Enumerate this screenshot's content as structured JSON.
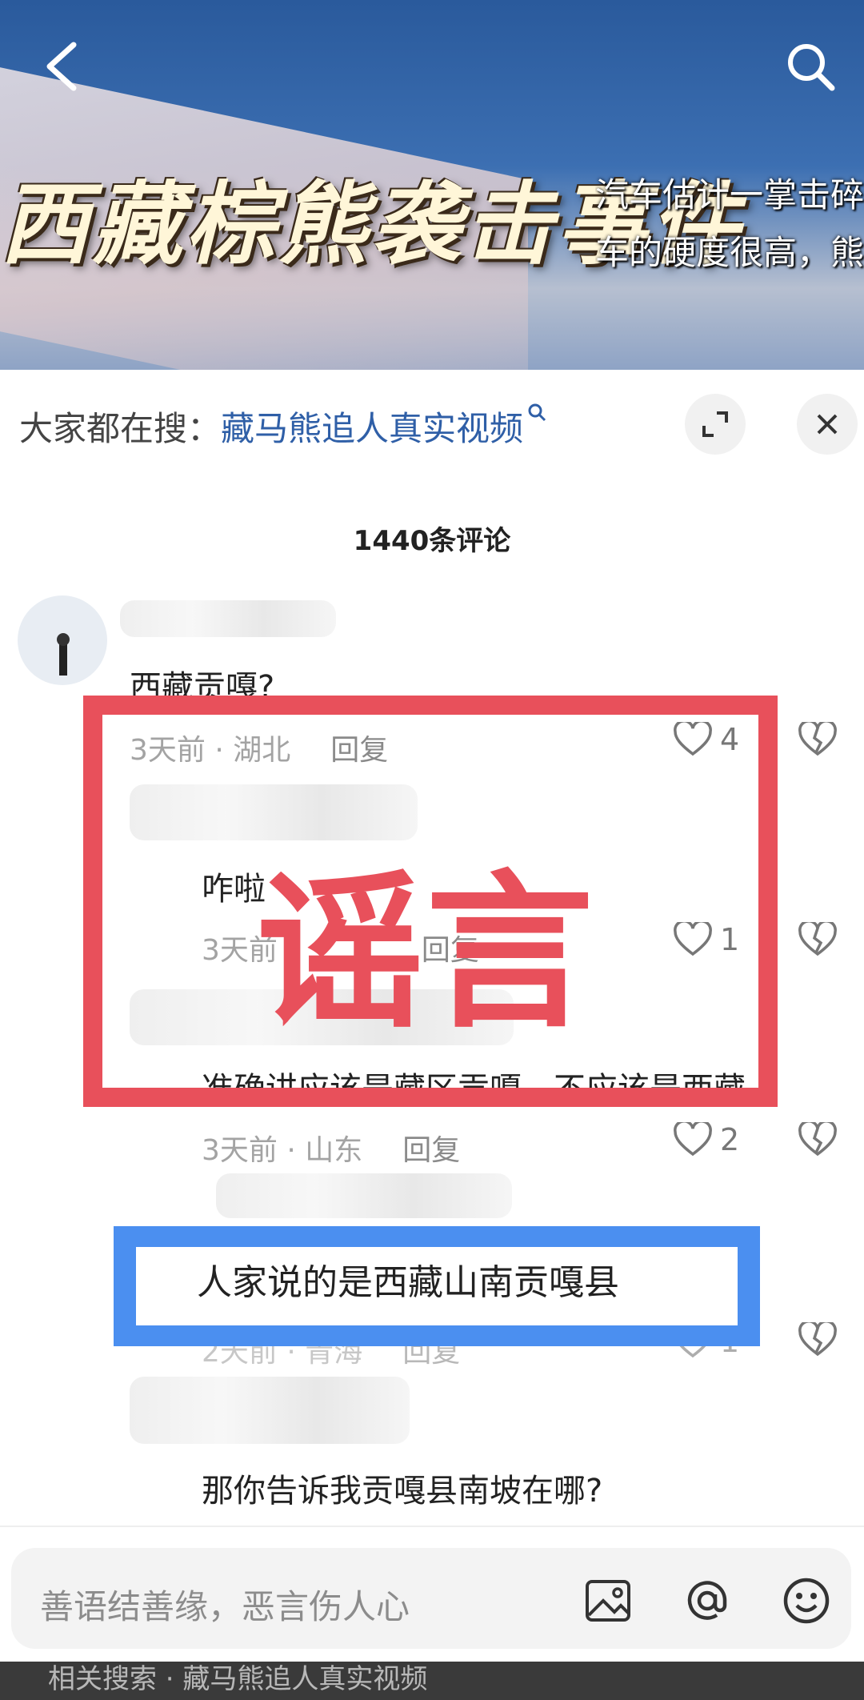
{
  "video": {
    "title": "西藏棕熊袭击事件",
    "subtitle_line1": "汽车估计一掌击碎",
    "subtitle_line2": "车的硬度很高，熊"
  },
  "hot_search": {
    "label": "大家都在搜：",
    "keyword": "藏马熊追人真实视频"
  },
  "comments_count": "1440条评论",
  "comments": [
    {
      "text": "西藏贡嘎?",
      "time": "3天前",
      "region": "湖北",
      "reply": "回复",
      "likes": "4"
    },
    {
      "text": "咋啦",
      "time": "3天前",
      "region": "",
      "reply": "回复",
      "likes": "1"
    },
    {
      "text": "准确讲应该是藏区贡嘎，不应该是西藏",
      "time": "3天前",
      "region": "山东",
      "reply": "回复",
      "likes": "2"
    },
    {
      "text": "人家说的是西藏山南贡嘎县",
      "time": "2天前",
      "region": "青海",
      "reply": "回复",
      "likes": "1"
    },
    {
      "text": "那你告诉我贡嘎县南坡在哪?",
      "time": "",
      "region": "",
      "reply": "",
      "likes": ""
    }
  ],
  "overlay": {
    "stamp": "谣言"
  },
  "input": {
    "placeholder": "善语结善缘，恶言伤人心"
  },
  "bottom_hint": "相关搜索 · 藏马熊追人真实视频"
}
